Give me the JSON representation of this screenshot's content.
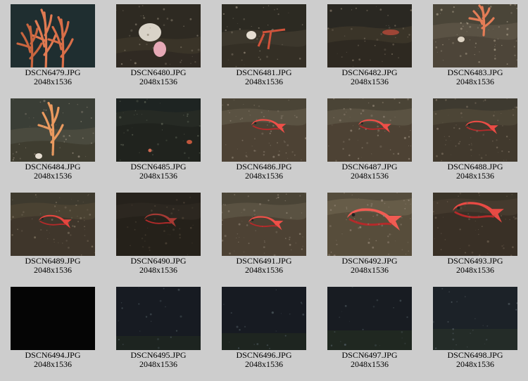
{
  "gallery": {
    "items": [
      {
        "filename": "DSCN6479.JPG",
        "dims": "2048x1536",
        "subject": "orange sea fan coral",
        "bg": "#2a3a3a"
      },
      {
        "filename": "DSCN6480.JPG",
        "dims": "2048x1536",
        "subject": "white sponge and anemone",
        "bg": "#2e2a22"
      },
      {
        "filename": "DSCN6481.JPG",
        "dims": "2048x1536",
        "subject": "red crab on seafloor",
        "bg": "#2c2a22"
      },
      {
        "filename": "DSCN6482.JPG",
        "dims": "2048x1536",
        "subject": "dark rocky seafloor",
        "bg": "#2a2822"
      },
      {
        "filename": "DSCN6483.JPG",
        "dims": "2048x1536",
        "subject": "orange coral on sandy seafloor",
        "bg": "#4a4538"
      },
      {
        "filename": "DSCN6484.JPG",
        "dims": "2048x1536",
        "subject": "orange sea fan coral",
        "bg": "#3a3e36"
      },
      {
        "filename": "DSCN6485.JPG",
        "dims": "2048x1536",
        "subject": "dark seafloor",
        "bg": "#1e2422"
      },
      {
        "filename": "DSCN6486.JPG",
        "dims": "2048x1536",
        "subject": "red rockfish",
        "bg": "#4a4436"
      },
      {
        "filename": "DSCN6487.JPG",
        "dims": "2048x1536",
        "subject": "red rockfish",
        "bg": "#4a4436"
      },
      {
        "filename": "DSCN6488.JPG",
        "dims": "2048x1536",
        "subject": "red rockfish",
        "bg": "#3e3a30"
      },
      {
        "filename": "DSCN6489.JPG",
        "dims": "2048x1536",
        "subject": "red rockfish",
        "bg": "#3e3a2e"
      },
      {
        "filename": "DSCN6490.JPG",
        "dims": "2048x1536",
        "subject": "red rockfish in dim light",
        "bg": "#26221c"
      },
      {
        "filename": "DSCN6491.JPG",
        "dims": "2048x1536",
        "subject": "red rockfish",
        "bg": "#4a4436"
      },
      {
        "filename": "DSCN6492.JPG",
        "dims": "2048x1536",
        "subject": "red rockfish close-up",
        "bg": "#544c3c"
      },
      {
        "filename": "DSCN6493.JPG",
        "dims": "2048x1536",
        "subject": "red rockfish close-up",
        "bg": "#3a3428"
      },
      {
        "filename": "DSCN6494.JPG",
        "dims": "2048x1536",
        "subject": "black frame",
        "bg": "#050505"
      },
      {
        "filename": "DSCN6495.JPG",
        "dims": "2048x1536",
        "subject": "dark water",
        "bg": "#171b22"
      },
      {
        "filename": "DSCN6496.JPG",
        "dims": "2048x1536",
        "subject": "dark water",
        "bg": "#171b22"
      },
      {
        "filename": "DSCN6497.JPG",
        "dims": "2048x1536",
        "subject": "dark water",
        "bg": "#181c22"
      },
      {
        "filename": "DSCN6498.JPG",
        "dims": "2048x1536",
        "subject": "dark water",
        "bg": "#1c2228"
      }
    ]
  }
}
